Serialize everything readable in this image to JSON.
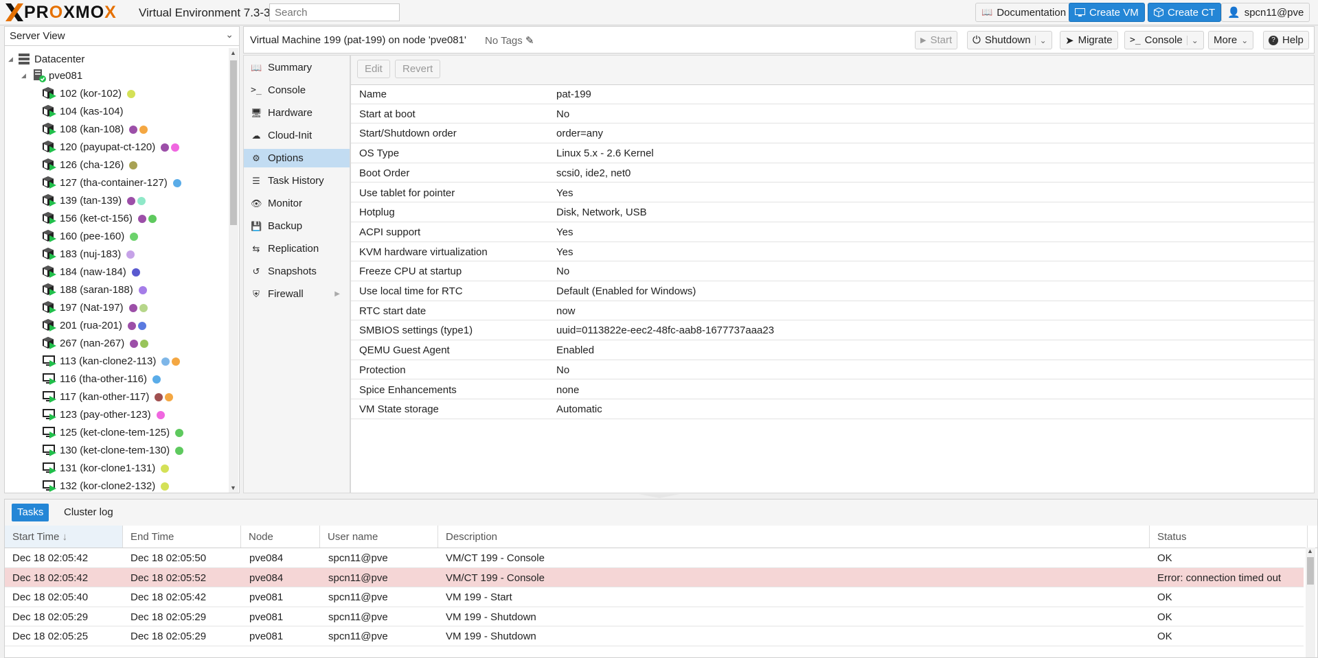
{
  "header": {
    "logo_text": "PROXMOX",
    "version": "Virtual Environment 7.3-3",
    "search_placeholder": "Search",
    "documentation": "Documentation",
    "create_vm": "Create VM",
    "create_ct": "Create CT",
    "user": "spcn11@pve"
  },
  "sidebar": {
    "view": "Server View",
    "datacenter": "Datacenter",
    "node": "pve081",
    "items": [
      {
        "label": "102 (kor-102)",
        "type": "ct",
        "tags": [
          "#d4e157"
        ]
      },
      {
        "label": "104 (kas-104)",
        "type": "ct",
        "tags": []
      },
      {
        "label": "108 (kan-108)",
        "type": "ct",
        "tags": [
          "#9c4fa8",
          "#f4a742"
        ]
      },
      {
        "label": "120 (payupat-ct-120)",
        "type": "ct",
        "tags": [
          "#9c4fa8",
          "#f067e0"
        ]
      },
      {
        "label": "126 (cha-126)",
        "type": "ct",
        "tags": [
          "#a8a254"
        ]
      },
      {
        "label": "127 (tha-container-127)",
        "type": "ct",
        "tags": [
          "#5aace8"
        ]
      },
      {
        "label": "139 (tan-139)",
        "type": "ct",
        "tags": [
          "#9c4fa8",
          "#8fe8c8"
        ]
      },
      {
        "label": "156 (ket-ct-156)",
        "type": "ct",
        "tags": [
          "#9c4fa8",
          "#5ec95e"
        ]
      },
      {
        "label": "160 (pee-160)",
        "type": "ct",
        "tags": [
          "#6cd26c"
        ]
      },
      {
        "label": "183 (nuj-183)",
        "type": "ct",
        "tags": [
          "#c6a2e8"
        ]
      },
      {
        "label": "184 (naw-184)",
        "type": "ct",
        "tags": [
          "#5a5ad0"
        ]
      },
      {
        "label": "188 (saran-188)",
        "type": "ct",
        "tags": [
          "#a57de8"
        ]
      },
      {
        "label": "197 (Nat-197)",
        "type": "ct",
        "tags": [
          "#9c4fa8",
          "#b6d68a"
        ]
      },
      {
        "label": "201 (rua-201)",
        "type": "ct",
        "tags": [
          "#9c4fa8",
          "#5a7ae0"
        ]
      },
      {
        "label": "267 (nan-267)",
        "type": "ct",
        "tags": [
          "#9c4fa8",
          "#98c45a"
        ]
      },
      {
        "label": "113 (kan-clone2-113)",
        "type": "vm",
        "tags": [
          "#7eb6e8",
          "#f4a742"
        ]
      },
      {
        "label": "116 (tha-other-116)",
        "type": "vm",
        "tags": [
          "#5aace8"
        ]
      },
      {
        "label": "117 (kan-other-117)",
        "type": "vm",
        "tags": [
          "#a05050",
          "#f4a742"
        ]
      },
      {
        "label": "123 (pay-other-123)",
        "type": "vm",
        "tags": [
          "#f067e0"
        ]
      },
      {
        "label": "125 (ket-clone-tem-125)",
        "type": "vm",
        "tags": [
          "#5ec95e"
        ]
      },
      {
        "label": "130 (ket-clone-tem-130)",
        "type": "vm",
        "tags": [
          "#5ec95e"
        ]
      },
      {
        "label": "131 (kor-clone1-131)",
        "type": "vm",
        "tags": [
          "#d4e157"
        ]
      },
      {
        "label": "132 (kor-clone2-132)",
        "type": "vm",
        "tags": [
          "#d4e157"
        ]
      }
    ]
  },
  "content": {
    "title": "Virtual Machine 199 (pat-199) on node 'pve081'",
    "no_tags": "No Tags",
    "buttons": {
      "start": "Start",
      "shutdown": "Shutdown",
      "migrate": "Migrate",
      "console": "Console",
      "more": "More",
      "help": "Help"
    }
  },
  "subnav": {
    "items": [
      {
        "label": "Summary",
        "icon": "book-icon"
      },
      {
        "label": "Console",
        "icon": "terminal-icon"
      },
      {
        "label": "Hardware",
        "icon": "monitor-icon"
      },
      {
        "label": "Cloud-Init",
        "icon": "cloud-icon"
      },
      {
        "label": "Options",
        "icon": "gear-icon",
        "active": true
      },
      {
        "label": "Task History",
        "icon": "list-icon"
      },
      {
        "label": "Monitor",
        "icon": "eye-icon"
      },
      {
        "label": "Backup",
        "icon": "floppy-icon"
      },
      {
        "label": "Replication",
        "icon": "retweet-icon"
      },
      {
        "label": "Snapshots",
        "icon": "history-icon"
      },
      {
        "label": "Firewall",
        "icon": "shield-icon"
      }
    ]
  },
  "options": {
    "edit": "Edit",
    "revert": "Revert",
    "rows": [
      {
        "key": "Name",
        "value": "pat-199"
      },
      {
        "key": "Start at boot",
        "value": "No"
      },
      {
        "key": "Start/Shutdown order",
        "value": "order=any"
      },
      {
        "key": "OS Type",
        "value": "Linux 5.x - 2.6 Kernel"
      },
      {
        "key": "Boot Order",
        "value": "scsi0, ide2, net0"
      },
      {
        "key": "Use tablet for pointer",
        "value": "Yes"
      },
      {
        "key": "Hotplug",
        "value": "Disk, Network, USB"
      },
      {
        "key": "ACPI support",
        "value": "Yes"
      },
      {
        "key": "KVM hardware virtualization",
        "value": "Yes"
      },
      {
        "key": "Freeze CPU at startup",
        "value": "No"
      },
      {
        "key": "Use local time for RTC",
        "value": "Default (Enabled for Windows)"
      },
      {
        "key": "RTC start date",
        "value": "now"
      },
      {
        "key": "SMBIOS settings (type1)",
        "value": "uuid=0113822e-eec2-48fc-aab8-1677737aaa23"
      },
      {
        "key": "QEMU Guest Agent",
        "value": "Enabled"
      },
      {
        "key": "Protection",
        "value": "No"
      },
      {
        "key": "Spice Enhancements",
        "value": "none"
      },
      {
        "key": "VM State storage",
        "value": "Automatic"
      }
    ]
  },
  "tasks": {
    "tab_tasks": "Tasks",
    "tab_cluster_log": "Cluster log",
    "columns": {
      "start": "Start Time",
      "end": "End Time",
      "node": "Node",
      "user": "User name",
      "desc": "Description",
      "status": "Status"
    },
    "rows": [
      {
        "start": "Dec 18 02:05:42",
        "end": "Dec 18 02:05:50",
        "node": "pve084",
        "user": "spcn11@pve",
        "desc": "VM/CT 199 - Console",
        "status": "OK",
        "error": false
      },
      {
        "start": "Dec 18 02:05:42",
        "end": "Dec 18 02:05:52",
        "node": "pve084",
        "user": "spcn11@pve",
        "desc": "VM/CT 199 - Console",
        "status": "Error: connection timed out",
        "error": true
      },
      {
        "start": "Dec 18 02:05:40",
        "end": "Dec 18 02:05:42",
        "node": "pve081",
        "user": "spcn11@pve",
        "desc": "VM 199 - Start",
        "status": "OK",
        "error": false
      },
      {
        "start": "Dec 18 02:05:29",
        "end": "Dec 18 02:05:29",
        "node": "pve081",
        "user": "spcn11@pve",
        "desc": "VM 199 - Shutdown",
        "status": "OK",
        "error": false
      },
      {
        "start": "Dec 18 02:05:25",
        "end": "Dec 18 02:05:29",
        "node": "pve081",
        "user": "spcn11@pve",
        "desc": "VM 199 - Shutdown",
        "status": "OK",
        "error": false
      }
    ]
  }
}
